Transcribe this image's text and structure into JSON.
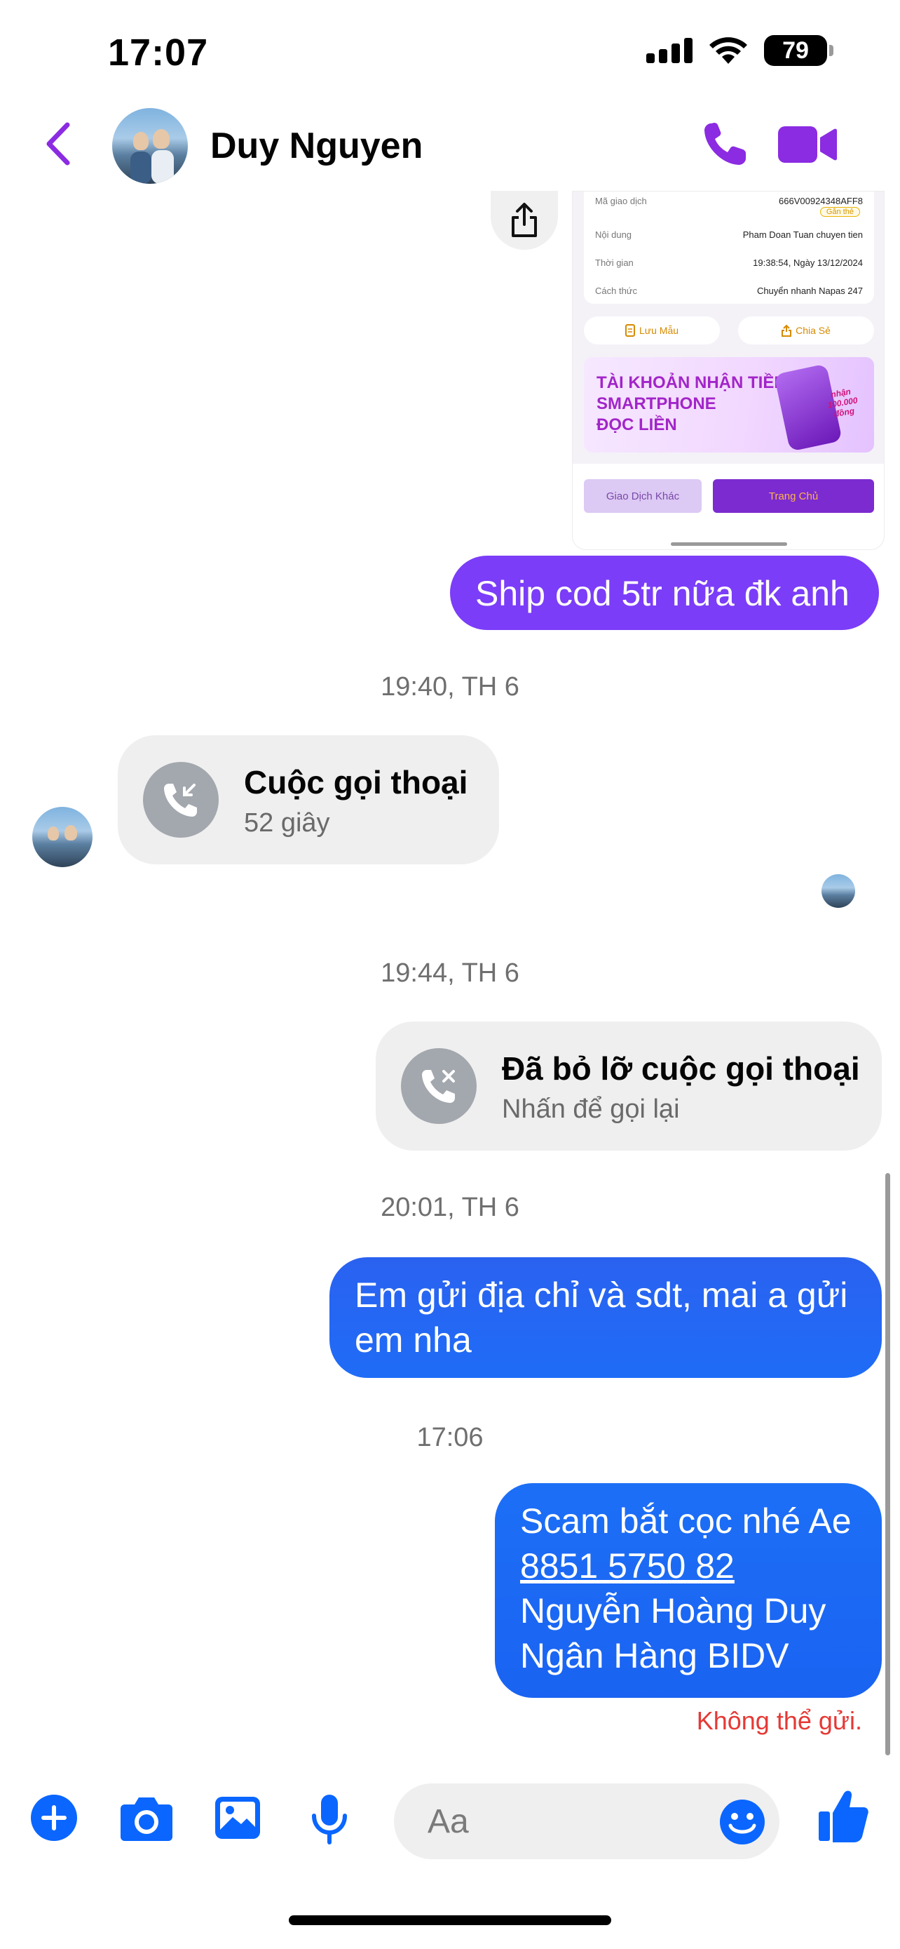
{
  "status_bar": {
    "time": "17:07",
    "battery": "79",
    "icons": [
      "signal-icon",
      "wifi-icon",
      "battery-icon"
    ]
  },
  "header": {
    "contact_name": "Duy Nguyen",
    "icons": [
      "back-chevron-icon",
      "phone-icon",
      "video-camera-icon"
    ],
    "accent_color": "#8b2be2"
  },
  "receipt_image": {
    "rows": [
      {
        "label": "Mã giao dịch",
        "value": "666V00924348AFF8"
      },
      {
        "label": "",
        "value": "Gắn thẻ"
      },
      {
        "label": "Nội dung",
        "value": "Pham Doan Tuan chuyen tien"
      },
      {
        "label": "Thời gian",
        "value": "19:38:54, Ngày 13/12/2024"
      },
      {
        "label": "Cách thức",
        "value": "Chuyển nhanh Napas 247"
      }
    ],
    "save_label": "Lưu Mẫu",
    "share_label": "Chia Sẻ",
    "banner_text": "TÀI KHOẢN NHẬN TIỀN\nSMARTPHONE\nĐỌC LIỀN",
    "banner_tag": "nhận 100.000 đồng",
    "other_tx_label": "Giao Dịch Khác",
    "home_label": "Trang Chủ"
  },
  "messages": {
    "ship_cod": "Ship cod 5tr nữa đk anh",
    "ts1": "19:40, TH 6",
    "call1_title": "Cuộc gọi thoại",
    "call1_duration": "52 giây",
    "ts2": "19:44, TH 6",
    "missed_title": "Đã bỏ lỡ cuộc gọi thoại",
    "missed_sub": "Nhấn để gọi lại",
    "ts3": "20:01, TH 6",
    "address_line1": "Em gửi địa chỉ và sdt, mai a gửi",
    "address_line2": "em nha",
    "ts4": "17:06",
    "scam_line1": "Scam bắt cọc nhé Ae",
    "scam_line2": "8851 5750 82",
    "scam_line3": "Nguyễn Hoàng Duy",
    "scam_line4": "Ngân Hàng BIDV",
    "error": "Không thể gửi.",
    "colors": {
      "outgoing_purple": "#7b3df8",
      "outgoing_blue": "#1f6cf7",
      "error_red": "#e53935"
    }
  },
  "composer": {
    "placeholder": "Aa",
    "icons": [
      "plus-icon",
      "camera-icon",
      "image-icon",
      "microphone-icon",
      "emoji-icon",
      "thumbs-up-icon"
    ],
    "icon_color": "#0a66ff"
  }
}
